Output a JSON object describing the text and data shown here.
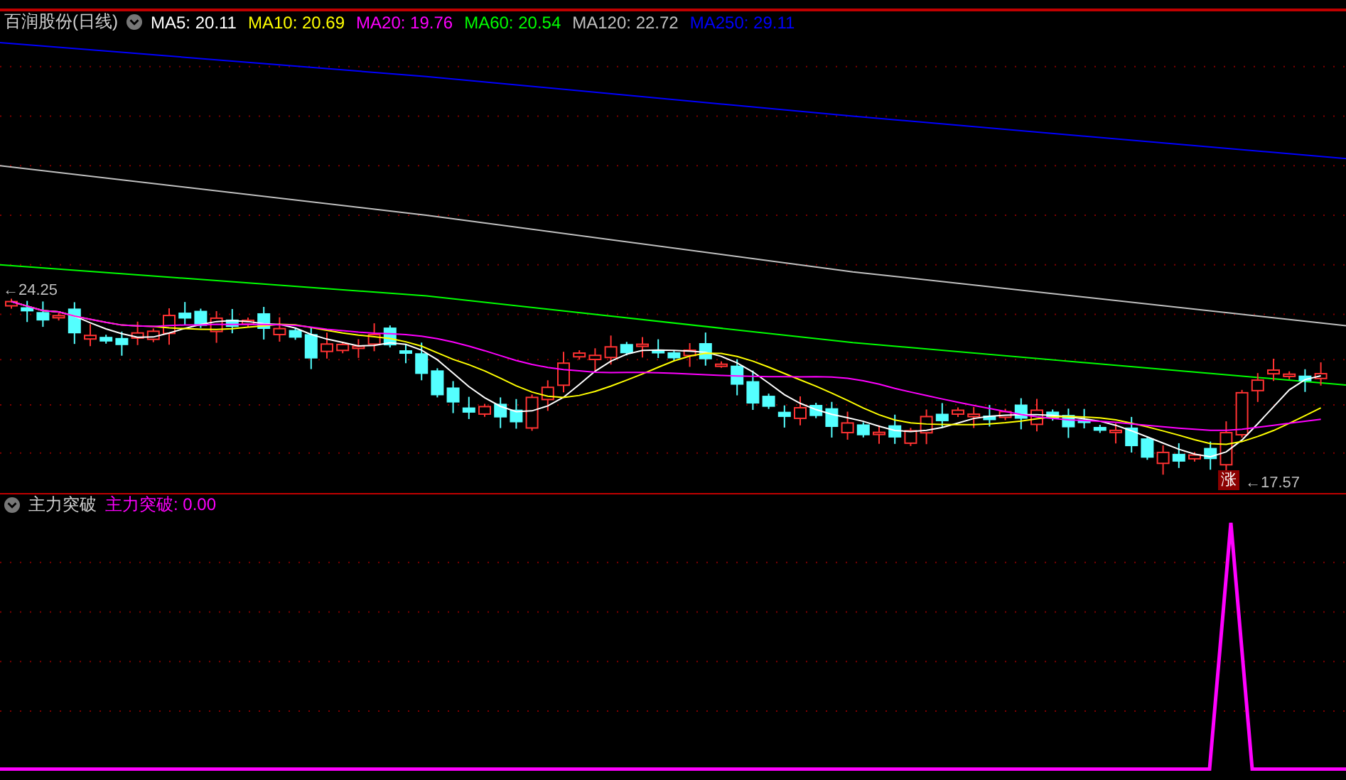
{
  "chart": {
    "title": "百润股份(日线)",
    "ma": [
      {
        "label": "MA5: 20.11",
        "color": "#ffffff"
      },
      {
        "label": "MA10: 20.69",
        "color": "#ffff00"
      },
      {
        "label": "MA20: 19.76",
        "color": "#ff00ff"
      },
      {
        "label": "MA60: 20.54",
        "color": "#00ff00"
      },
      {
        "label": "MA120: 22.72",
        "color": "#c0c0c0"
      },
      {
        "label": "MA250: 29.11",
        "color": "#0000ff"
      }
    ],
    "high_label": "←24.25",
    "low_label": "←17.57",
    "badge": "涨"
  },
  "indicator": {
    "title": "主力突破",
    "legend": [
      {
        "label": "主力突破: 0.00",
        "color": "#ff00ff"
      }
    ]
  }
}
